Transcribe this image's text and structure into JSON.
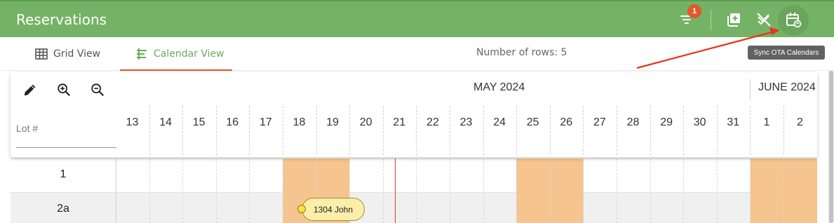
{
  "app": {
    "title": "Reservations"
  },
  "header": {
    "filter_badge": "1",
    "icons": [
      "filter-icon",
      "add-reservation-icon",
      "unsync-icon",
      "sync-calendar-icon"
    ]
  },
  "tabs": [
    {
      "label": "Grid View",
      "icon": "grid-icon",
      "active": false
    },
    {
      "label": "Calendar View",
      "icon": "calendar-tree-icon",
      "active": true
    }
  ],
  "rows_count": "Number of rows: 5",
  "tooltip": "Sync OTA Calendars",
  "calendar": {
    "tools": [
      "edit-icon",
      "zoom-in-icon",
      "zoom-out-icon"
    ],
    "months": [
      "MAY 2024",
      "JUNE 2024"
    ],
    "lot_header": "Lot #",
    "days": [
      "13",
      "14",
      "15",
      "16",
      "17",
      "18",
      "19",
      "20",
      "21",
      "22",
      "23",
      "24",
      "25",
      "26",
      "27",
      "28",
      "29",
      "30",
      "31",
      "1",
      "2"
    ],
    "rows": [
      {
        "lot": "1"
      },
      {
        "lot": "2a"
      }
    ],
    "reservation": {
      "label": "1304 John"
    }
  },
  "colors": {
    "header_green": "#74b365",
    "accent_orange": "#e2582b",
    "weekend": "#f5c48f",
    "active_tab": "#6aab5a",
    "reservation": "#fbeea9"
  }
}
